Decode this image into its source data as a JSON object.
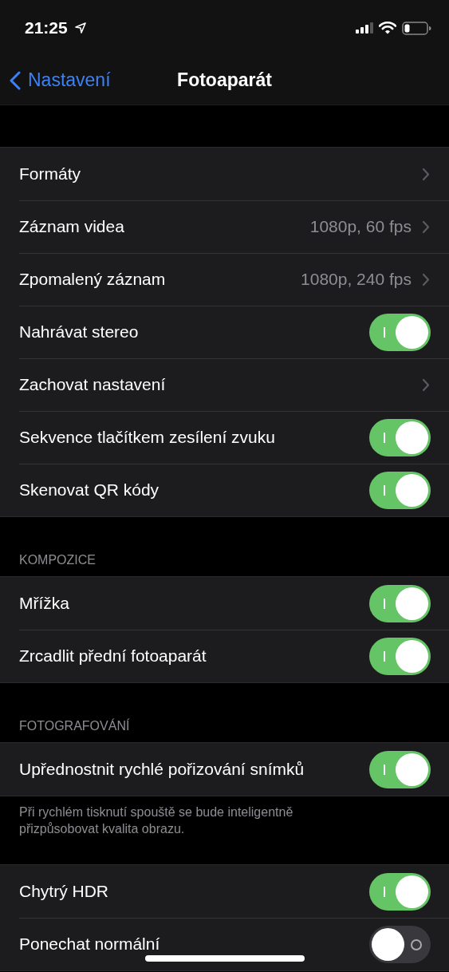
{
  "status_bar": {
    "time": "21:25"
  },
  "nav": {
    "back": "Nastavení",
    "title": "Fotoaparát"
  },
  "sections": [
    {
      "rows": [
        {
          "kind": "link",
          "label": "Formáty"
        },
        {
          "kind": "link",
          "label": "Záznam videa",
          "value": "1080p, 60 fps"
        },
        {
          "kind": "link",
          "label": "Zpomalený záznam",
          "value": "1080p, 240 fps"
        },
        {
          "kind": "toggle",
          "label": "Nahrávat stereo",
          "on": true
        },
        {
          "kind": "link",
          "label": "Zachovat nastavení"
        },
        {
          "kind": "toggle",
          "label": "Sekvence tlačítkem zesílení zvuku",
          "on": true
        },
        {
          "kind": "toggle",
          "label": "Skenovat QR kódy",
          "on": true
        }
      ]
    },
    {
      "header": "KOMPOZICE",
      "rows": [
        {
          "kind": "toggle",
          "label": "Mřížka",
          "on": true
        },
        {
          "kind": "toggle",
          "label": "Zrcadlit přední fotoaparát",
          "on": true
        }
      ]
    },
    {
      "header": "FOTOGRAFOVÁNÍ",
      "rows": [
        {
          "kind": "toggle",
          "label": "Upřednostnit rychlé pořizování snímků",
          "on": true
        }
      ],
      "footer": "Při rychlém tisknutí spouště se bude inteligentně přizpůsobovat kvalita obrazu."
    },
    {
      "rows": [
        {
          "kind": "toggle",
          "label": "Chytrý HDR",
          "on": true
        },
        {
          "kind": "toggle",
          "label": "Ponechat normální",
          "on": false
        }
      ]
    }
  ]
}
